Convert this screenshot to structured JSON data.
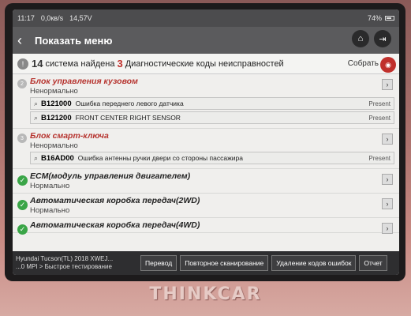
{
  "statusbar": {
    "time": "11:17",
    "net_speed": "0,0кв/s",
    "voltage": "14,57V",
    "battery": "74%"
  },
  "header": {
    "back_icon": "chevron-left",
    "title": "Показать меню",
    "home_icon": "home-icon",
    "exit_icon": "exit-icon"
  },
  "summary": {
    "count_systems": "14",
    "systems_text": "система найдена",
    "count_codes": "3",
    "codes_text": "Диагностические коды неисправностей",
    "collect_label": "Собрать"
  },
  "systems": [
    {
      "index": "2",
      "name": "Блок управления кузовом",
      "status": "Ненормально",
      "dtcs": [
        {
          "code": "B121000",
          "desc": "Ошибка переднего левого датчика",
          "state": "Present"
        },
        {
          "code": "B121200",
          "desc": "FRONT CENTER RIGHT SENSOR",
          "state": "Present"
        }
      ]
    },
    {
      "index": "3",
      "name": "Блок смарт-ключа",
      "status": "Ненормально",
      "dtcs": [
        {
          "code": "B16AD00",
          "desc": "Ошибка антенны ручки двери со стороны пассажира",
          "state": "Present"
        }
      ]
    },
    {
      "name": "ECM(модуль управления двигателем)",
      "status": "Нормально"
    },
    {
      "name": "Автоматическая коробка передач(2WD)",
      "status": "Нормально"
    },
    {
      "name": "Автоматическая коробка передач(4WD)",
      "status": ""
    }
  ],
  "footer": {
    "vehicle_line1": "Hyundai  Tucson(TL) 2018  XWEJ...",
    "vehicle_line2": "...0 MPI > Быстрое тестирование",
    "btn_translate": "Перевод",
    "btn_rescan": "Повторное сканирование",
    "btn_clear": "Удаление кодов ошибок",
    "btn_report": "Отчет"
  },
  "brand": "THINKCAR"
}
